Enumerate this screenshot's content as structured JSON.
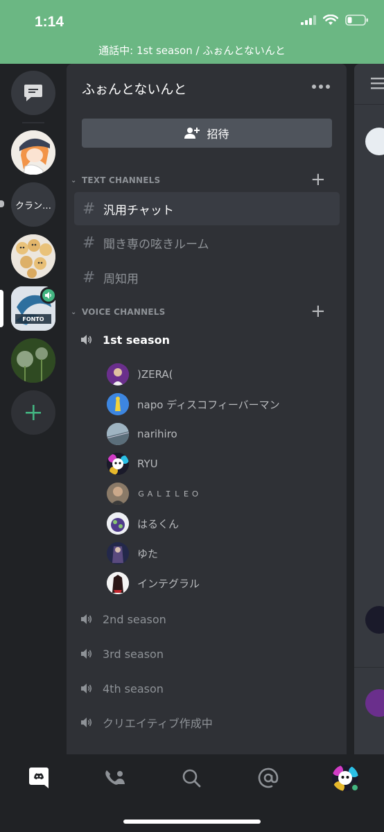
{
  "status_bar": {
    "time": "1:14"
  },
  "call_banner": {
    "text": "通話中: 1st season / ふぉんとないんと"
  },
  "servers": {
    "clan_label": "クラン…"
  },
  "guild": {
    "name": "ふぉんとないんと",
    "invite_label": "招待"
  },
  "categories": {
    "text": "TEXT CHANNELS",
    "voice": "VOICE CHANNELS"
  },
  "text_channels": [
    {
      "name": "汎用チャット"
    },
    {
      "name": "聞き専の呟きルーム"
    },
    {
      "name": "周知用"
    }
  ],
  "voice_channels": [
    {
      "name": "1st season"
    },
    {
      "name": "2nd season"
    },
    {
      "name": "3rd season"
    },
    {
      "name": "4th season"
    },
    {
      "name": "クリエイティブ作成中"
    }
  ],
  "voice_users": [
    {
      "name": ")ZERA("
    },
    {
      "name": "napo ディスコフィーバーマン"
    },
    {
      "name": "narihiro"
    },
    {
      "name": "RYU"
    },
    {
      "name": "ＧＡＬＩＬＥＯ"
    },
    {
      "name": "はるくん"
    },
    {
      "name": "ゆた"
    },
    {
      "name": "インテグラル"
    }
  ],
  "colors": {
    "call_green": "#6bb783",
    "online_green": "#43b581",
    "panel": "#2f3136",
    "rail": "#202225"
  }
}
